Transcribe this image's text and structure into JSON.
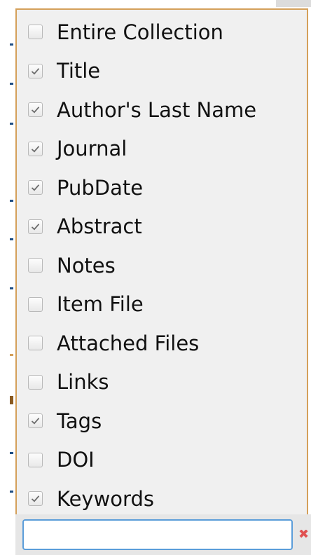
{
  "filter_options": [
    {
      "label": "Entire Collection",
      "checked": false
    },
    {
      "label": "Title",
      "checked": true
    },
    {
      "label": "Author's Last Name",
      "checked": true
    },
    {
      "label": "Journal",
      "checked": true
    },
    {
      "label": "PubDate",
      "checked": true
    },
    {
      "label": "Abstract",
      "checked": true
    },
    {
      "label": "Notes",
      "checked": false
    },
    {
      "label": "Item File",
      "checked": false
    },
    {
      "label": "Attached Files",
      "checked": false
    },
    {
      "label": "Links",
      "checked": false
    },
    {
      "label": "Tags",
      "checked": true
    },
    {
      "label": "DOI",
      "checked": false
    },
    {
      "label": "Keywords",
      "checked": true
    }
  ],
  "search": {
    "value": "",
    "clear_icon": "clear-x-icon"
  },
  "colors": {
    "dropdown_border": "#d4a05a",
    "input_focus_border": "#5b9dd9",
    "clear_icon": "#e05050"
  }
}
